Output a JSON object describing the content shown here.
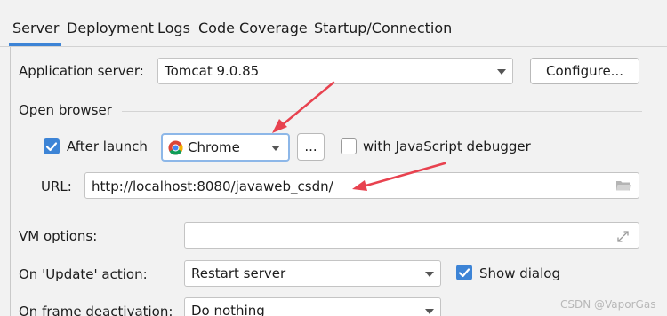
{
  "tabs": [
    {
      "label": "Server",
      "active": true
    },
    {
      "label": "Deployment"
    },
    {
      "label": "Logs"
    },
    {
      "label": "Code Coverage"
    },
    {
      "label": "Startup/Connection"
    }
  ],
  "application_server": {
    "label": "Application server:",
    "value": "Tomcat 9.0.85",
    "configure_label": "Configure..."
  },
  "open_browser": {
    "section_label": "Open browser",
    "after_launch_label": "After launch",
    "after_launch_checked": true,
    "browser_value": "Chrome",
    "browse_button_label": "...",
    "js_debugger_label": "with JavaScript debugger",
    "js_debugger_checked": false,
    "url_label": "URL:",
    "url_value": "http://localhost:8080/javaweb_csdn/"
  },
  "vm_options": {
    "label": "VM options:",
    "value": ""
  },
  "update_action": {
    "label": "On 'Update' action:",
    "value": "Restart server",
    "show_dialog_label": "Show dialog",
    "show_dialog_checked": true
  },
  "frame_deactivation": {
    "label": "On frame deactivation:",
    "value": "Do nothing"
  },
  "watermark": "CSDN @VaporGas",
  "colors": {
    "accent": "#3d84d6",
    "annotation_arrow": "#e8424f",
    "background": "#f2f2f2"
  },
  "icons": {
    "browser": "chrome-icon",
    "url_browse": "folder-icon",
    "vm_expand": "expand-icon"
  }
}
